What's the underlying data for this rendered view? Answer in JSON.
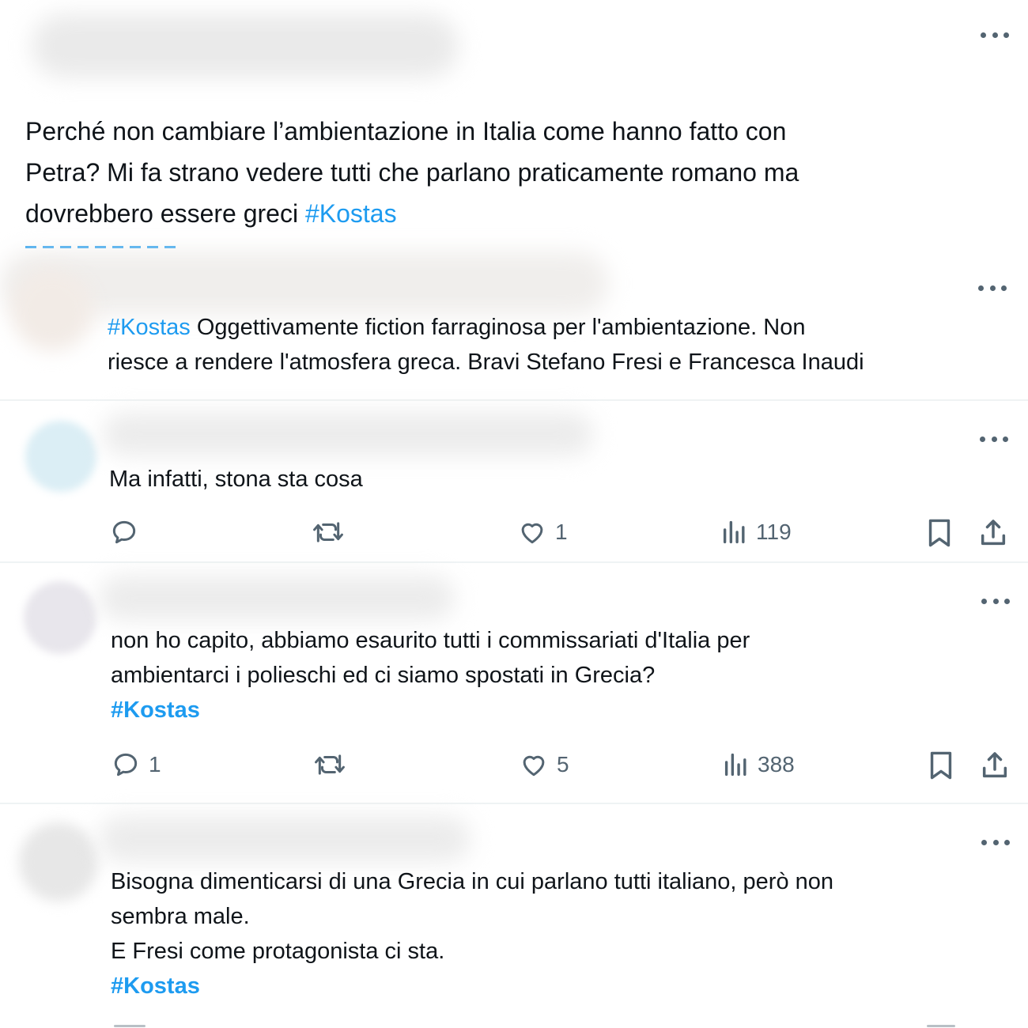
{
  "colors": {
    "accent": "#1d9bf0",
    "text": "#0f1419",
    "muted": "#536471",
    "divider": "#eff3f4"
  },
  "main_tweet": {
    "lines": [
      "Perché non cambiare l’ambientazione in Italia come hanno fatto con",
      "Petra? Mi fa strano vedere tutti che parlano praticamente romano ma",
      "dovrebbero essere greci "
    ],
    "hashtag": "#Kostas"
  },
  "replies": [
    {
      "hashtag": "#Kostas",
      "line1_rest": " Oggettivamente fiction farraginosa per l'ambientazione. Non",
      "line2": "riesce a rendere l'atmosfera greca. Bravi Stefano Fresi e Francesca Inaudi"
    },
    {
      "line1": "Ma infatti, stona sta cosa",
      "stats": {
        "replies": "",
        "retweets": "",
        "likes": "1",
        "views": "119"
      }
    },
    {
      "line1": "non ho capito, abbiamo esaurito tutti i commissariati d'Italia per",
      "line2": "ambientarci i polieschi ed ci siamo spostati in Grecia?",
      "hashtag": "#Kostas",
      "stats": {
        "replies": "1",
        "retweets": "",
        "likes": "5",
        "views": "388"
      }
    },
    {
      "line1": "Bisogna dimenticarsi di una Grecia in cui parlano tutti italiano, però non",
      "line2": "sembra male.",
      "line3": "E Fresi come protagonista ci sta.",
      "hashtag": "#Kostas"
    }
  ],
  "icons": [
    "more-icon",
    "reply-icon",
    "retweet-icon",
    "like-icon",
    "views-icon",
    "bookmark-icon",
    "share-icon"
  ]
}
